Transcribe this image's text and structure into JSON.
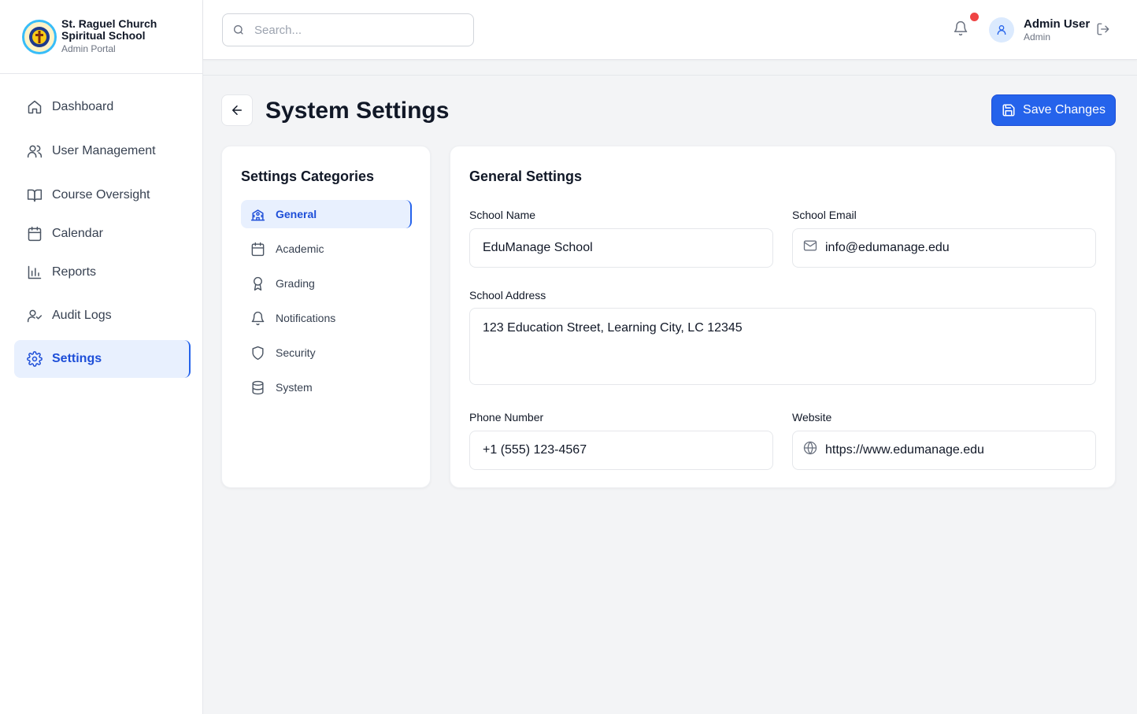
{
  "brand": {
    "title_line1": "St. Raguel  Church",
    "title_line2": "Spiritual School",
    "subtitle": "Admin Portal"
  },
  "sidebar": {
    "items": [
      {
        "label": "Dashboard",
        "icon": "home-icon"
      },
      {
        "label": "User Management",
        "icon": "users-icon"
      },
      {
        "label": "Course Oversight",
        "icon": "book-icon"
      },
      {
        "label": "Calendar",
        "icon": "calendar-icon"
      },
      {
        "label": "Reports",
        "icon": "bar-chart-icon"
      },
      {
        "label": "Audit Logs",
        "icon": "user-check-icon"
      },
      {
        "label": "Settings",
        "icon": "gear-icon",
        "active": true
      }
    ]
  },
  "topbar": {
    "search_placeholder": "Search...",
    "user_name": "Admin User",
    "user_role": "Admin",
    "notification_color": "#ef4444"
  },
  "header": {
    "title": "System Settings",
    "save_label": "Save Changes",
    "accent": "#2563eb"
  },
  "categories": {
    "title": "Settings Categories",
    "items": [
      {
        "label": "General",
        "icon": "school-icon",
        "active": true
      },
      {
        "label": "Academic",
        "icon": "calendar-icon"
      },
      {
        "label": "Grading",
        "icon": "award-icon"
      },
      {
        "label": "Notifications",
        "icon": "bell-icon"
      },
      {
        "label": "Security",
        "icon": "shield-icon"
      },
      {
        "label": "System",
        "icon": "database-icon"
      }
    ]
  },
  "general": {
    "title": "General Settings",
    "school_name_label": "School Name",
    "school_name": "EduManage School",
    "school_email_label": "School Email",
    "school_email": "info@edumanage.edu",
    "address_label": "School Address",
    "address": "123 Education Street, Learning City, LC 12345",
    "phone_label": "Phone Number",
    "phone": "+1 (555) 123-4567",
    "website_label": "Website",
    "website": "https://www.edumanage.edu"
  }
}
